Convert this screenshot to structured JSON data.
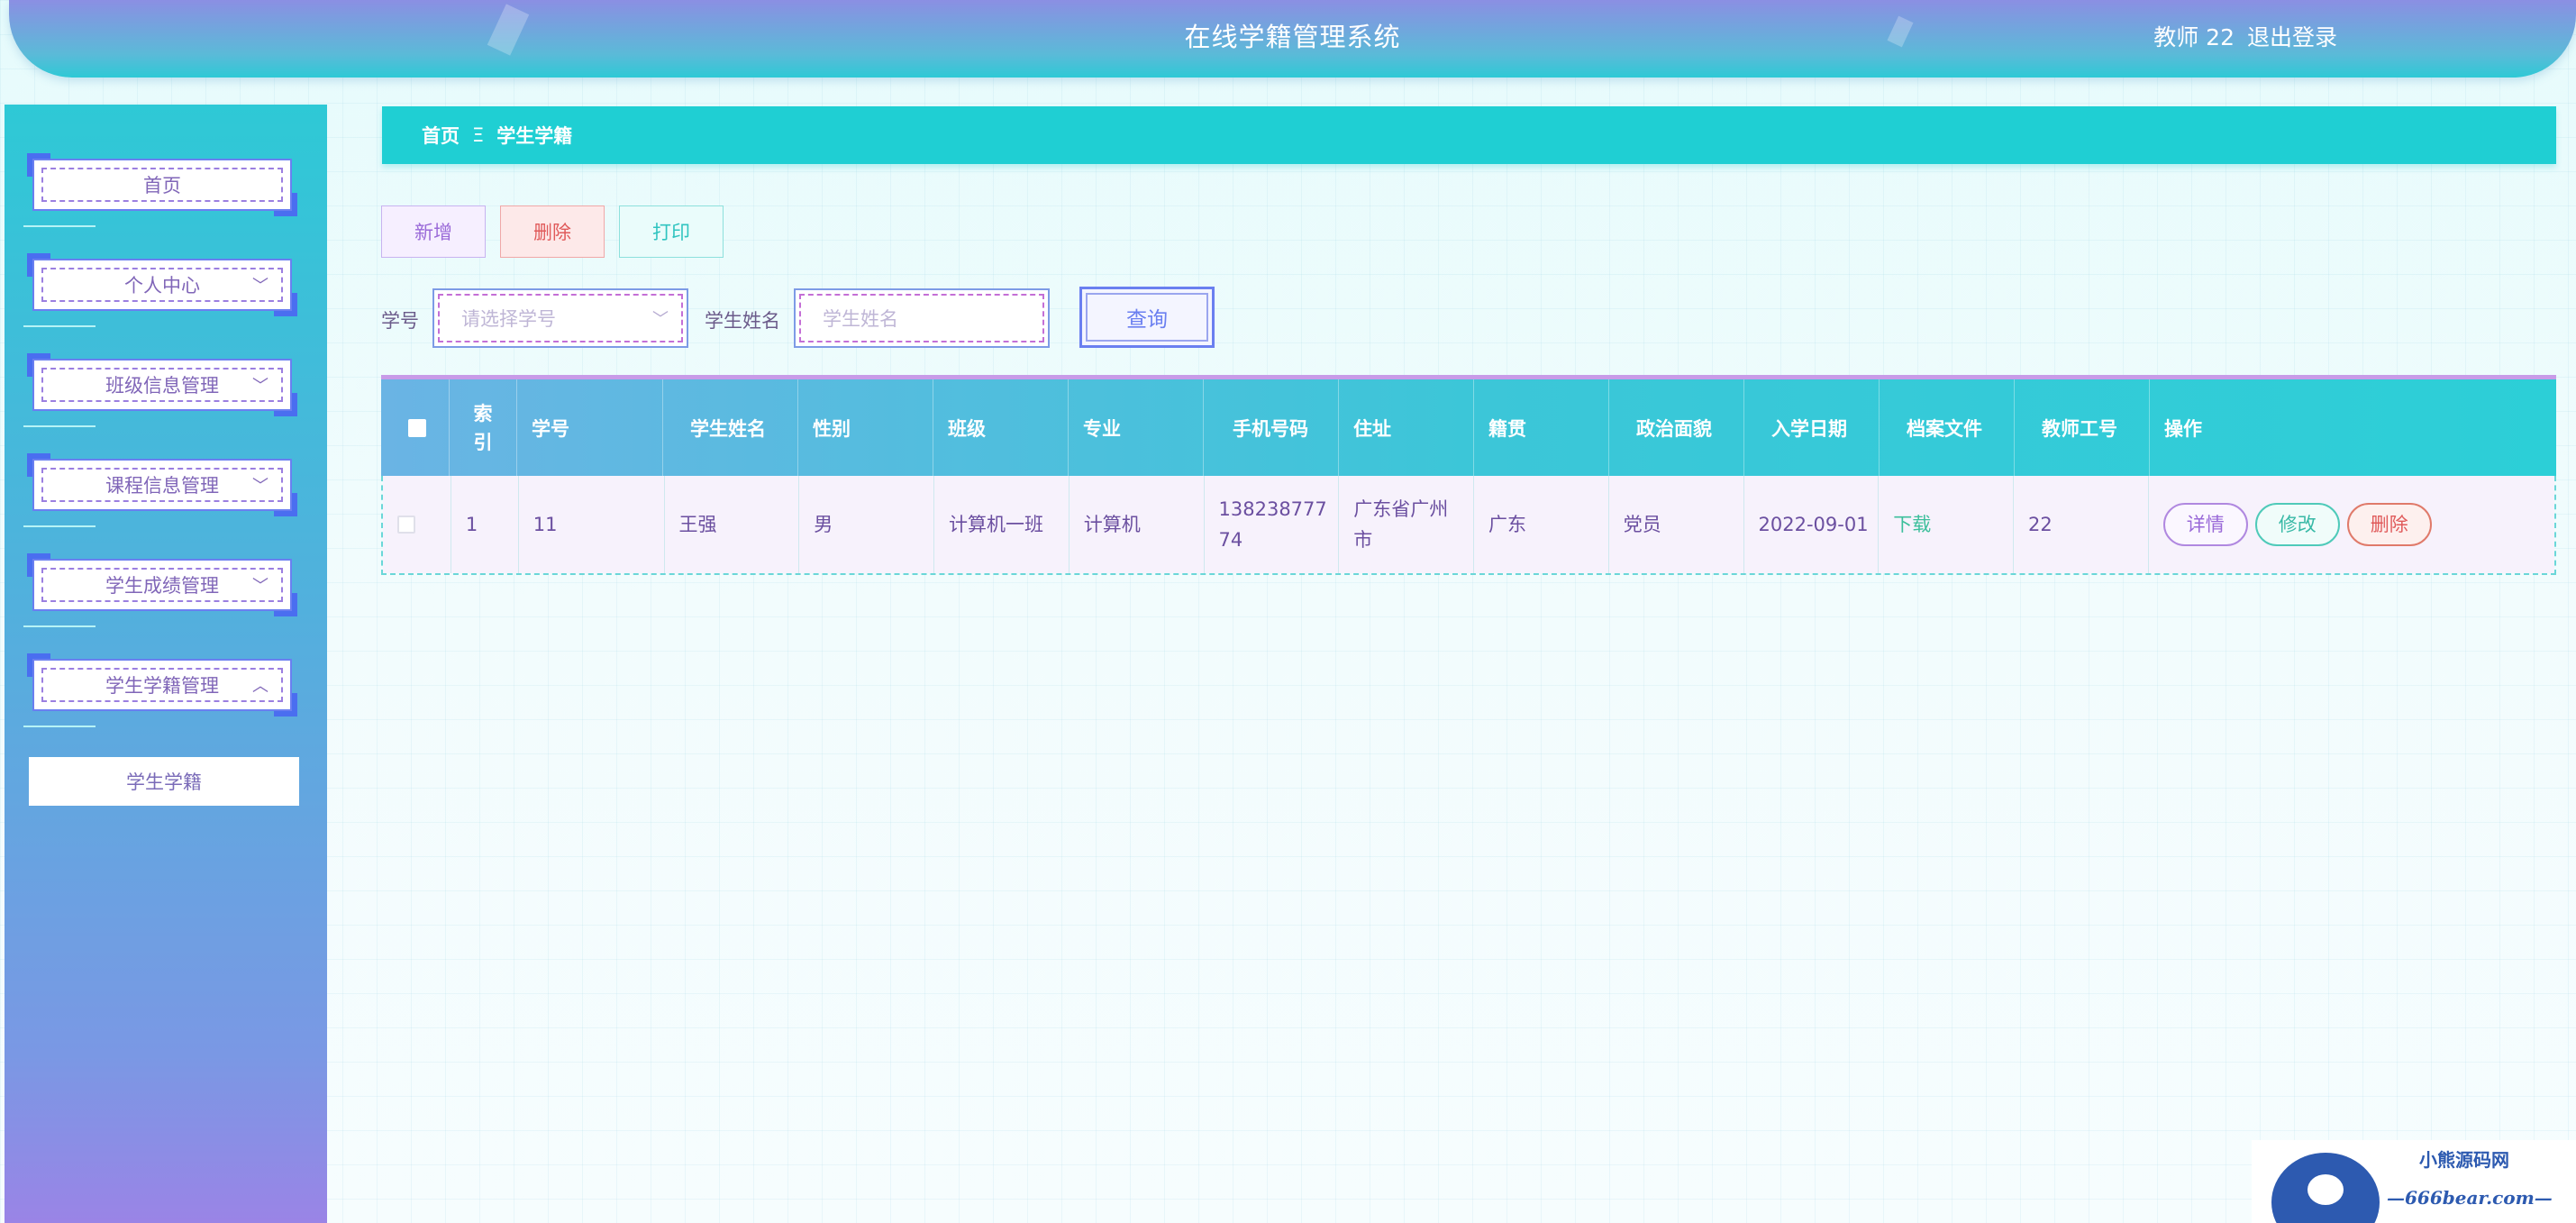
{
  "header": {
    "title": "在线学籍管理系统",
    "user": "教师 22",
    "logout": "退出登录"
  },
  "sidebar": {
    "items": [
      {
        "label": "首页",
        "icon": ""
      },
      {
        "label": "个人中心",
        "icon": "chevron-down-icon"
      },
      {
        "label": "班级信息管理",
        "icon": "chevron-down-icon"
      },
      {
        "label": "课程信息管理",
        "icon": "chevron-down-icon"
      },
      {
        "label": "学生成绩管理",
        "icon": "chevron-down-icon"
      },
      {
        "label": "学生学籍管理",
        "icon": "chevron-up-icon"
      }
    ],
    "sub_item": "学生学籍"
  },
  "breadcrumb": {
    "home": "首页",
    "separator": "Ξ",
    "current": "学生学籍"
  },
  "actions": {
    "add": "新增",
    "delete": "删除",
    "print": "打印"
  },
  "search": {
    "student_no_label": "学号",
    "student_no_placeholder": "请选择学号",
    "student_name_label": "学生姓名",
    "student_name_placeholder": "学生姓名",
    "query": "查询"
  },
  "table": {
    "headers": [
      "索引",
      "学号",
      "学生姓名",
      "性别",
      "班级",
      "专业",
      "手机号码",
      "住址",
      "籍贯",
      "政治面貌",
      "入学日期",
      "档案文件",
      "教师工号",
      "操作"
    ],
    "rows": [
      {
        "index": "1",
        "student_no": "11",
        "name": "王强",
        "gender": "男",
        "class": "计算机一班",
        "major": "计算机",
        "phone_line1": "138238777",
        "phone_line2": "74",
        "address_line1": "广东省广州",
        "address_line2": "市",
        "native_place": "广东",
        "political": "党员",
        "enroll_date": "2022-09-01",
        "file": "下载",
        "teacher_no": "22",
        "op_detail": "详情",
        "op_edit": "修改",
        "op_delete": "删除"
      }
    ]
  },
  "watermark": {
    "line1": "小熊源码网",
    "line2": "—666bear.com—"
  },
  "colors": {
    "accent": "#1fcfd3",
    "menu_frame": "#4a6ef0",
    "danger": "#e05a5a"
  }
}
